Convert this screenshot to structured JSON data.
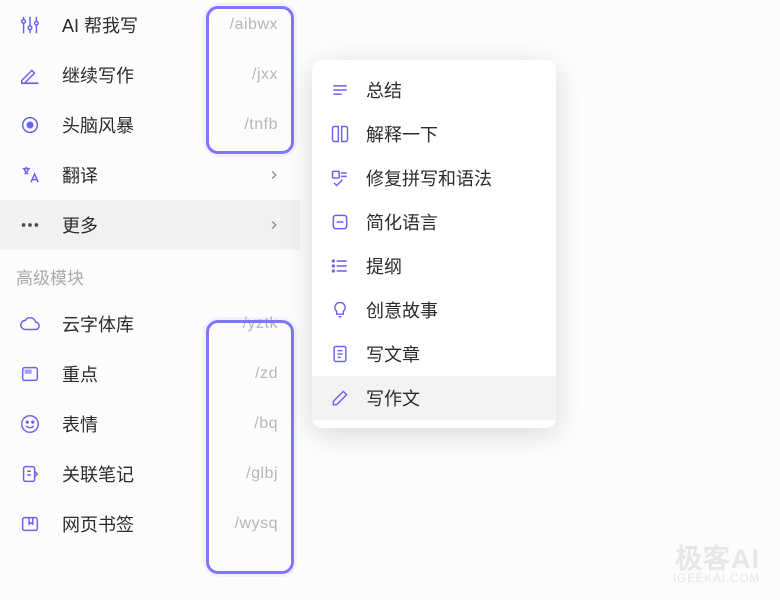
{
  "sidebar": {
    "items": [
      {
        "label": "AI 帮我写",
        "shortcut": "/aibwx"
      },
      {
        "label": "继续写作",
        "shortcut": "/jxx"
      },
      {
        "label": "头脑风暴",
        "shortcut": "/tnfb"
      },
      {
        "label": "翻译",
        "shortcut": "",
        "arrow": true
      },
      {
        "label": "更多",
        "shortcut": "",
        "arrow": true
      }
    ],
    "section_title": "高级模块",
    "advanced": [
      {
        "label": "云字体库",
        "shortcut": "/yztk"
      },
      {
        "label": "重点",
        "shortcut": "/zd"
      },
      {
        "label": "表情",
        "shortcut": "/bq"
      },
      {
        "label": "关联笔记",
        "shortcut": "/glbj"
      },
      {
        "label": "网页书签",
        "shortcut": "/wysq"
      }
    ]
  },
  "popup": {
    "items": [
      {
        "label": "总结"
      },
      {
        "label": "解释一下"
      },
      {
        "label": "修复拼写和语法"
      },
      {
        "label": "简化语言"
      },
      {
        "label": "提纲"
      },
      {
        "label": "创意故事"
      },
      {
        "label": "写文章"
      },
      {
        "label": "写作文"
      }
    ]
  },
  "watermark": {
    "title": "极客AI",
    "url": "IGEEKAI.COM"
  }
}
